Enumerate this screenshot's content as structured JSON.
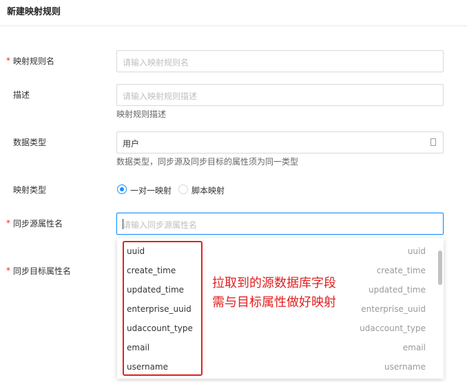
{
  "header": {
    "title": "新建映射规则"
  },
  "form": {
    "rule_name": {
      "label": "映射规则名",
      "required_mark": "*",
      "placeholder": "请输入映射规则名"
    },
    "description": {
      "label": "描述",
      "placeholder": "请输入映射规则描述",
      "help": "映射规则描述"
    },
    "data_type": {
      "label": "数据类型",
      "value": "用户",
      "help": "数据类型，同步源及同步目标的属性须为同一类型"
    },
    "mapping_type": {
      "label": "映射类型",
      "options": [
        "一对一映射",
        "脚本映射"
      ],
      "selected": "一对一映射"
    },
    "source_attr": {
      "label": "同步源属性名",
      "required_mark": "*",
      "placeholder": "请输入同步源属性名"
    },
    "target_attr": {
      "label": "同步目标属性名",
      "required_mark": "*"
    }
  },
  "dropdown": {
    "items": [
      {
        "left": "uuid",
        "right": "uuid"
      },
      {
        "left": "create_time",
        "right": "create_time"
      },
      {
        "left": "updated_time",
        "right": "updated_time"
      },
      {
        "left": "enterprise_uuid",
        "right": "enterprise_uuid"
      },
      {
        "left": "udaccount_type",
        "right": "udaccount_type"
      },
      {
        "left": "email",
        "right": "email"
      },
      {
        "left": "username",
        "right": "username"
      }
    ]
  },
  "annotation": {
    "line1": "拉取到的源数据库字段",
    "line2": "需与目标属性做好映射"
  },
  "colors": {
    "accent": "#1890ff",
    "required": "#f5222d",
    "annotation": "#e02020"
  }
}
